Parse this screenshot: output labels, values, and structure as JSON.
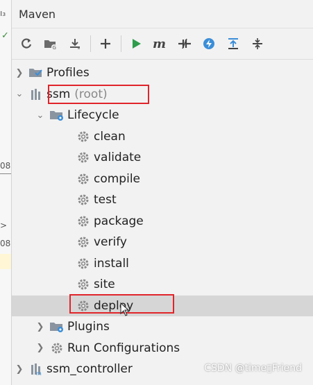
{
  "gutter": {
    "top_label": "ı₃",
    "num1": "08",
    "num2": "08",
    "caret": ">"
  },
  "panel": {
    "title": "Maven"
  },
  "toolbar": {
    "buttons": [
      "reload-icon",
      "folder-generate-icon",
      "download-icon",
      "add-icon",
      "run-icon",
      "maven-goal-icon",
      "toggle-offline-icon",
      "skip-tests-icon",
      "show-dependencies-icon",
      "collapse-icon"
    ],
    "run_color": "#2e9c4b",
    "accent_color": "#3b8ed8"
  },
  "tree": {
    "profiles": {
      "label": "Profiles"
    },
    "root": {
      "label": "ssm",
      "suffix": "(root)"
    },
    "lifecycle": {
      "label": "Lifecycle",
      "phases": [
        "clean",
        "validate",
        "compile",
        "test",
        "package",
        "verify",
        "install",
        "site",
        "deploy"
      ]
    },
    "plugins": {
      "label": "Plugins"
    },
    "run_configurations": {
      "label": "Run Configurations"
    },
    "module": {
      "label": "ssm_controller"
    }
  },
  "highlight_color": "#e0242a",
  "watermark": "CSDN @time▯Friend"
}
